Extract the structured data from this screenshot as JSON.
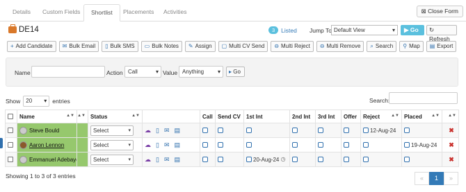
{
  "tabs": [
    {
      "label": "Details"
    },
    {
      "label": "Custom Fields"
    },
    {
      "label": "Shortlist"
    },
    {
      "label": "Placements"
    },
    {
      "label": "Activities"
    }
  ],
  "close_form": "Close Form",
  "header": {
    "title": "DE14",
    "listed_count": "3",
    "listed_label": "Listed",
    "jump_label": "Jump To",
    "jump_value": "Default View",
    "go_label": "Go",
    "refresh_label": "Refresh"
  },
  "toolbar": [
    {
      "label": "Add Candidate",
      "icon": "+"
    },
    {
      "label": "Bulk Email",
      "icon": "✉"
    },
    {
      "label": "Bulk SMS",
      "icon": "▯"
    },
    {
      "label": "Bulk Notes",
      "icon": "▭"
    },
    {
      "label": "Assign",
      "icon": "✎"
    },
    {
      "label": "Multi CV Send",
      "icon": "▢"
    },
    {
      "label": "Multi Reject",
      "icon": "⊖"
    },
    {
      "label": "Multi Remove",
      "icon": "⊖"
    },
    {
      "label": "Search",
      "icon": "⌕"
    },
    {
      "label": "Map",
      "icon": "⚲"
    },
    {
      "label": "Export",
      "icon": "▤"
    }
  ],
  "filter": {
    "name_label": "Name",
    "name_value": "",
    "action_label": "Action",
    "action_value": "Call",
    "value_label": "Value",
    "value_value": "Anything",
    "go_label": "Go"
  },
  "show": {
    "label": "Show",
    "value": "20",
    "suffix": "entries"
  },
  "search_label": "Search:",
  "columns": [
    "",
    "Name",
    "",
    "Status",
    "",
    "Call",
    "Send CV",
    "1st Int",
    "2nd Int",
    "3rd Int",
    "Offer",
    "Reject",
    "Placed",
    ""
  ],
  "rows": [
    {
      "name": "Steve Bould",
      "status": "Select",
      "int1_date": "",
      "reject_date": "12-Aug-24",
      "placed_date": ""
    },
    {
      "name": "Aaron Lennon",
      "status": "Select",
      "int1_date": "",
      "reject_date": "",
      "placed_date": "19-Aug-24"
    },
    {
      "name": "Emmanuel Adebayor",
      "status": "Select",
      "int1_date": "20-Aug-24",
      "reject_date": "",
      "placed_date": ""
    }
  ],
  "footer": {
    "showing": "Showing 1 to 3 of 3 entries",
    "prev": "«",
    "page": "1",
    "next": "»"
  }
}
